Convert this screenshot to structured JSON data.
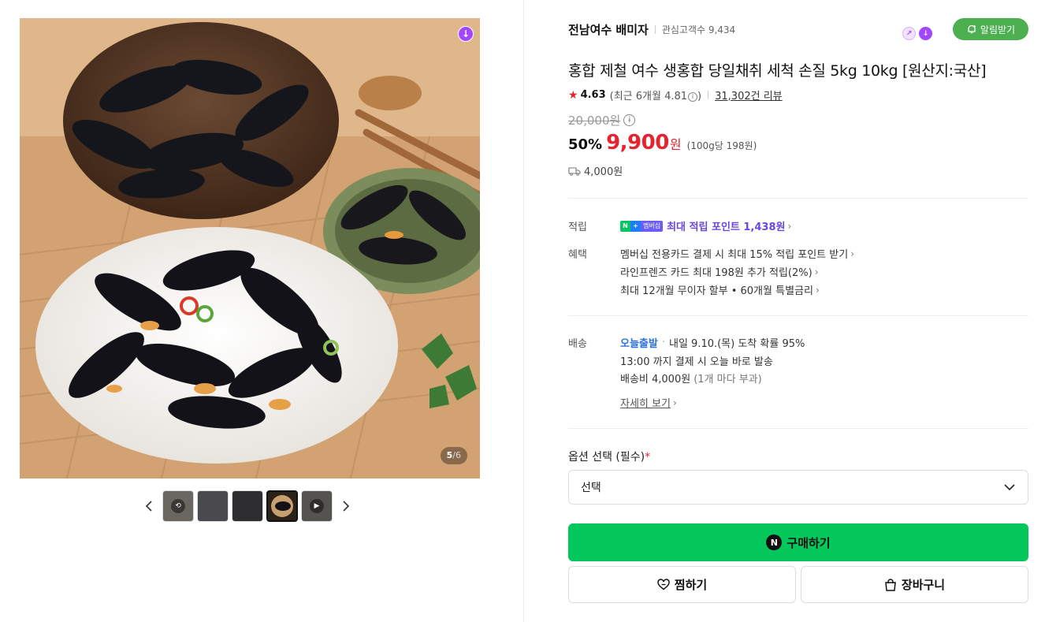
{
  "gallery": {
    "counter_current": "5",
    "counter_total": "/6",
    "thumbnails": [
      {
        "name": "thumb-1",
        "active": false,
        "overlay": "⟲"
      },
      {
        "name": "thumb-2",
        "active": false,
        "overlay": ""
      },
      {
        "name": "thumb-3",
        "active": false,
        "overlay": ""
      },
      {
        "name": "thumb-4",
        "active": true,
        "overlay": ""
      },
      {
        "name": "thumb-5",
        "active": false,
        "overlay": "▶"
      }
    ]
  },
  "store": {
    "name": "전남여수 배미자",
    "interest": "관심고객수 9,434",
    "alarm_label": "알림받기"
  },
  "product": {
    "title": "홍합 제철 여수 생홍합 당일채취 세척 손질 5kg 10kg [원산지:국산]",
    "rating": "4.63",
    "rating_recent": "(최근 6개월 4.81",
    "rating_recent_close": ")",
    "reviews": "31,302건 리뷰",
    "original_price": "20,000원",
    "discount": "50%",
    "sale_price": "9,900",
    "won": "원",
    "unit_price": "(100g당 198원)",
    "shipping_fee": "4,000원"
  },
  "benefits": {
    "points_label": "적립",
    "badge_n": "N",
    "badge_plus": "+",
    "badge_member": "멤버십",
    "points_text": "최대 적립 포인트 1,438원",
    "perks_label": "혜택",
    "perks": [
      "멤버십 전용카드 결제 시 최대 15% 적립 포인트 받기",
      "라인프렌즈 카드 최대 198원 추가 적립(2%)",
      "최대 12개월 무이자 할부 • 60개월 특별금리"
    ]
  },
  "delivery": {
    "label": "배송",
    "today": "오늘출발",
    "arrival": "내일 9.10.(목) 도착 확률 95%",
    "cutoff": "13:00 까지 결제 시 오늘 바로 발송",
    "fee": "배송비 4,000원",
    "fee_note": "(1개 마다 부과)",
    "details_link": "자세히 보기"
  },
  "options": {
    "label": "옵션 선택 (필수)",
    "required_mark": "*",
    "select_value": "선택"
  },
  "actions": {
    "buy": "구매하기",
    "wish": "찜하기",
    "cart": "장바구니"
  },
  "colors": {
    "naver_green": "#03c75a",
    "price_red": "#e4252f",
    "point_purple": "#6a47e0",
    "today_blue": "#2d73e0",
    "alarm_green": "#4cb050"
  }
}
